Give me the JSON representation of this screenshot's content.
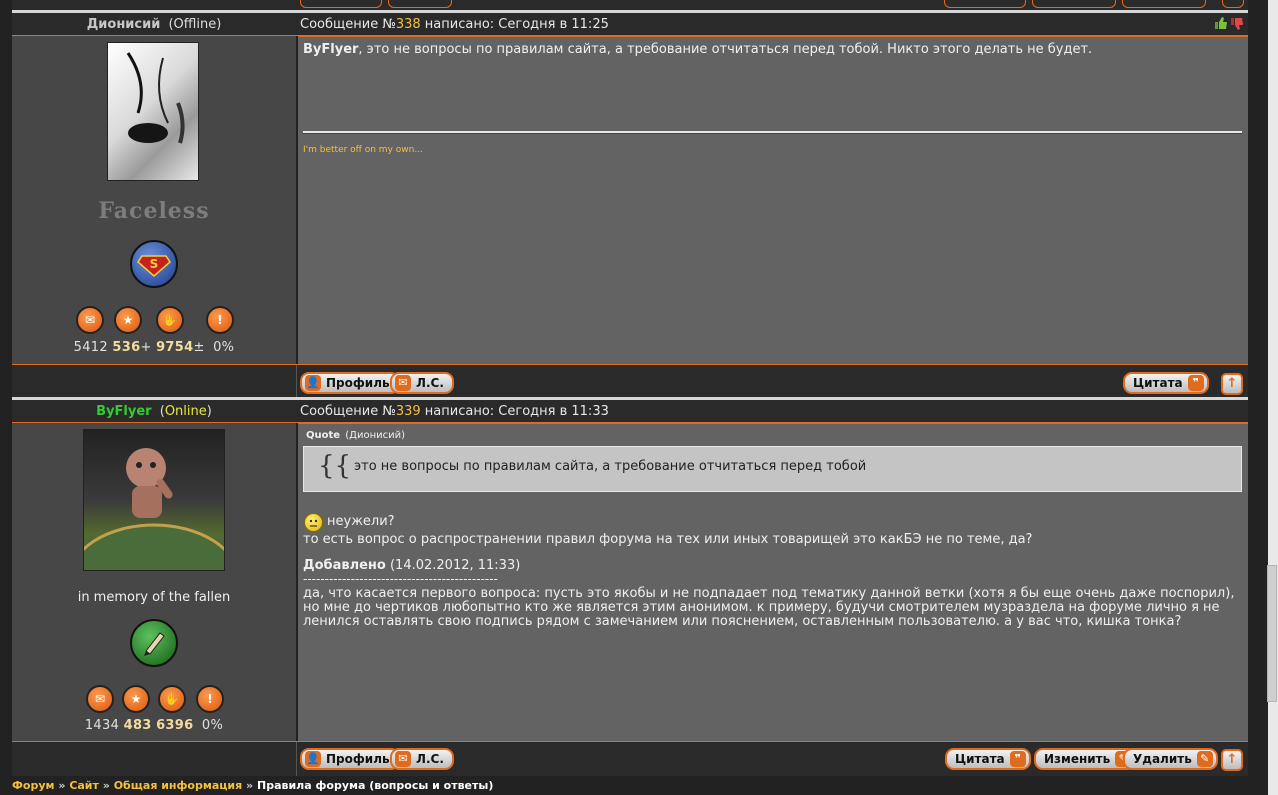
{
  "posts": [
    {
      "author": "Дионисий",
      "status": "(Offline)",
      "message_label": "Сообщение №",
      "message_number": "338",
      "written": " написано: Сегодня в 11:25",
      "user_title": "Faceless",
      "stats": {
        "a": "5412",
        "b": "536",
        "b_suffix": "+",
        "c": "9754",
        "c_suffix": "±",
        "d": "0%"
      },
      "body_bold": "ByFlyer",
      "body_text": ", это не вопросы по правилам сайта, а требование отчитаться перед тобой. Никто этого делать не будет.",
      "signature": "I'm better off on my own...",
      "buttons": {
        "profile": "Профиль",
        "pm": "Л.С.",
        "quote": "Цитата"
      }
    },
    {
      "author": "ByFlyer",
      "status": "Online",
      "message_label": "Сообщение №",
      "message_number": "339",
      "written": " написано: Сегодня в 11:33",
      "user_title": "in memory of the fallen",
      "stats": {
        "a": "1434",
        "b": "483",
        "c": "6396",
        "d": "0%"
      },
      "quote_label": "Quote",
      "quote_author": "(Дионисий)",
      "quote_text": "это не вопросы по правилам сайта, а требование отчитаться перед тобой",
      "line1": "неужели?",
      "line2": "то есть вопрос о распространении правил форума на тех или иных товарищей это какБЭ не по теме, да?",
      "added_label": "Добавлено",
      "added_date": "(14.02.2012, 11:33)",
      "dashes": "---------------------------------------------",
      "para": "да, что касается первого вопроса: пусть это якобы и не подпадает под тематику данной ветки (хотя я бы еще очень даже поспорил), но мне до чертиков любопытно кто же является этим анонимом. к примеру, будучи смотрителем музраздела на форуме лично я не ленился оставлять свою подпись рядом с замечанием или пояснением, оставленным пользователю. а у вас что, кишка тонка?",
      "buttons": {
        "profile": "Профиль",
        "pm": "Л.С.",
        "quote": "Цитата",
        "edit": "Изменить",
        "delete": "Удалить"
      }
    }
  ],
  "breadcrumb": {
    "items": [
      "Форум",
      "Сайт",
      "Общая информация"
    ],
    "current": "Правила форума (вопросы и ответы)",
    "separator": "»"
  },
  "colors": {
    "accent": "#e06b1e",
    "number": "#f3c13f",
    "online": "#33cc33",
    "background": "#222222"
  },
  "icons": [
    "thumbs-up-icon",
    "thumbs-down-icon",
    "superman-badge-icon",
    "pen-badge-icon",
    "chat-icon",
    "award-icon",
    "hand-icon",
    "warning-icon",
    "smile-icon",
    "up-arrow-icon"
  ]
}
